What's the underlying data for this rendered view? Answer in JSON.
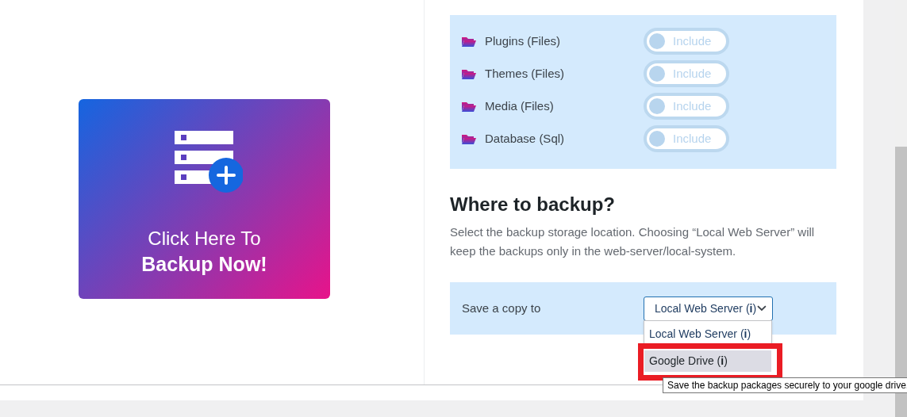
{
  "backup_card": {
    "line_1": "Click Here To",
    "line_2": "Backup Now!"
  },
  "contents": [
    {
      "label": "Plugins (Files)",
      "toggle_label": "Include",
      "on": false
    },
    {
      "label": "Themes (Files)",
      "toggle_label": "Include",
      "on": false
    },
    {
      "label": "Media (Files)",
      "toggle_label": "Include",
      "on": false
    },
    {
      "label": "Database (Sql)",
      "toggle_label": "Include",
      "on": false
    }
  ],
  "where": {
    "heading": "Where to backup?",
    "description": "Select the backup storage location. Choosing “Local Web Server” will keep the backups only in the web-server/local-system."
  },
  "save_copy": {
    "label": "Save a copy to",
    "value": "Local Web Server (**i**)",
    "expanded": true,
    "options": [
      {
        "label": "Local Web Server (**i**)",
        "highlighted": false,
        "annotated": false
      },
      {
        "label": "Google Drive (**i**)",
        "highlighted": true,
        "annotated": true
      }
    ]
  },
  "tooltip": "Save the backup packages securely to your google drive."
}
